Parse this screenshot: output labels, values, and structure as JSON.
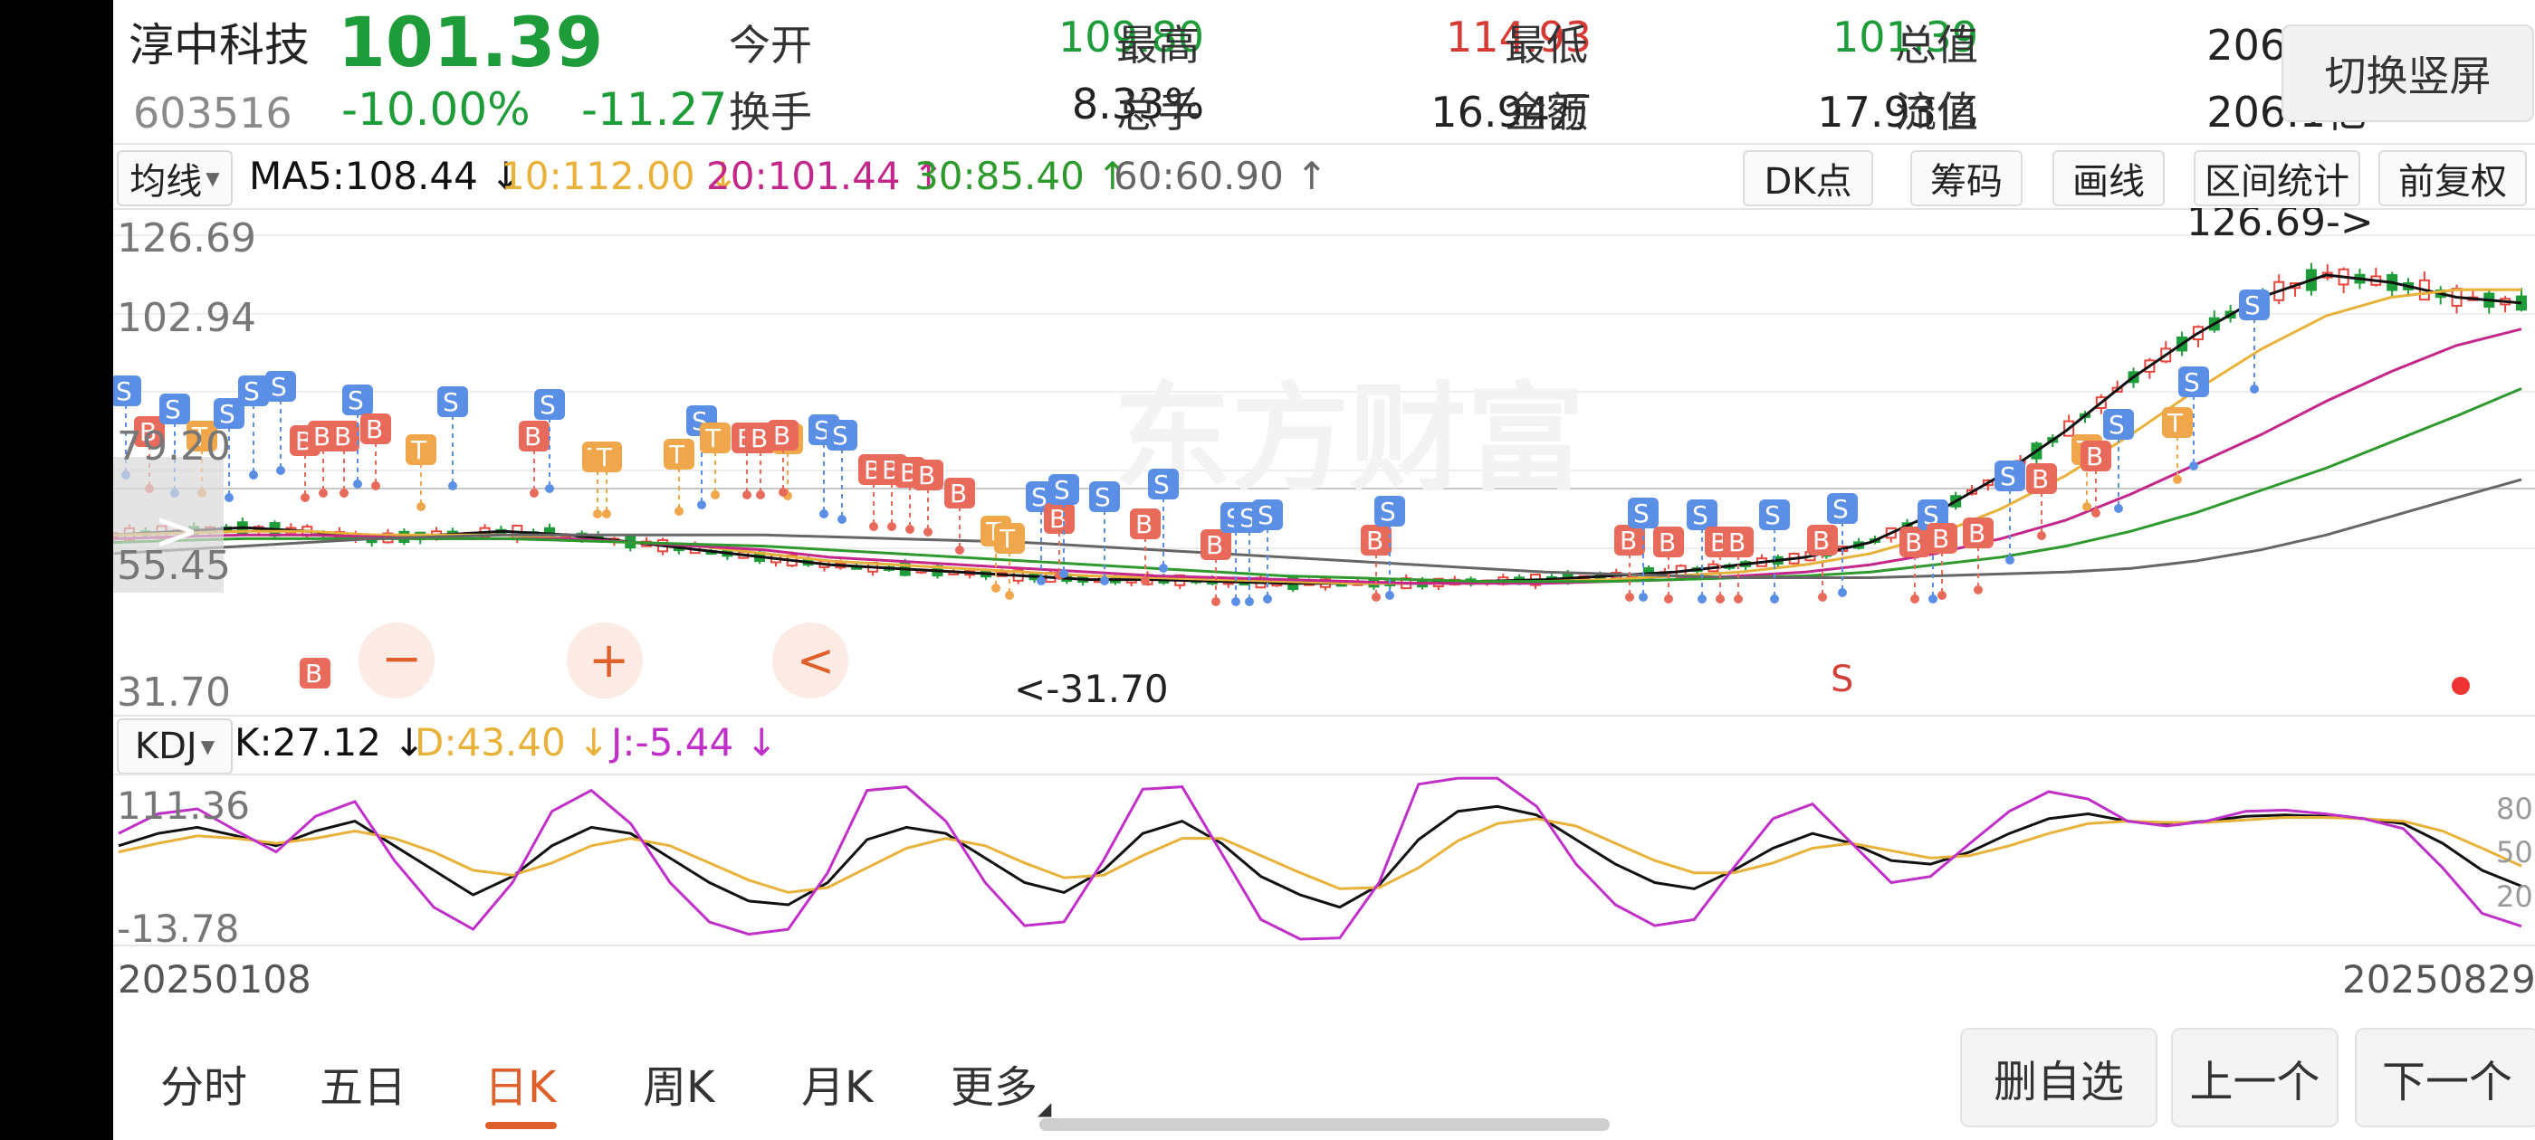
{
  "stock": {
    "name": "淳中科技",
    "price": "101.39",
    "code": "603516",
    "change_pct": "-10.00%",
    "change": "-11.27"
  },
  "quotes": {
    "open_label": "今开",
    "open": "109.80",
    "high_label": "最高",
    "high": "114.93",
    "low_label": "最低",
    "low": "101.39",
    "total_value_label": "总值",
    "total_value": "206.1亿",
    "turnover_label": "换手",
    "turnover": "8.33%",
    "volume_label": "总手",
    "volume": "16.94万",
    "amount_label": "金额",
    "amount": "17.93亿",
    "float_value_label": "流值",
    "float_value": "206.1亿"
  },
  "switch_button": "切换竖屏",
  "indicator": {
    "select": "均线",
    "ma5": "MA5:108.44 ↓",
    "ma10": "10:112.00 ↓",
    "ma20": "20:101.44 ↑",
    "ma30": "30:85.40 ↑",
    "ma60": "60:60.90 ↑"
  },
  "tools": [
    "DK点",
    "筹码",
    "画线",
    "区间统计",
    "前复权"
  ],
  "main_axis": {
    "y1": "126.69",
    "y2": "102.94",
    "y3": "79.20",
    "y4": "55.45",
    "y5": "31.70"
  },
  "annotations": {
    "high": "126.69->",
    "low": "<-31.70",
    "s_mark": "S"
  },
  "watermark": "东方财富",
  "overlay_buttons": {
    "minus": "−",
    "plus": "+",
    "back": "<",
    "expand": ">"
  },
  "kdj": {
    "select": "KDJ",
    "k": "K:27.12 ↓",
    "d": "D:43.40 ↓",
    "j": "J:-5.44 ↓"
  },
  "kdj_axis": {
    "top": "111.36",
    "bottom": "-13.78",
    "r80": "80",
    "r50": "50",
    "r20": "20"
  },
  "dates": {
    "start": "20250108",
    "end": "20250829"
  },
  "tabs": [
    {
      "label": "分时"
    },
    {
      "label": "五日"
    },
    {
      "label": "日K"
    },
    {
      "label": "周K"
    },
    {
      "label": "月K"
    },
    {
      "label": "更多"
    }
  ],
  "buttons": {
    "remove": "删自选",
    "prev": "上一个",
    "next": "下一个"
  },
  "colors": {
    "up": "#e8453c",
    "down": "#1f9c3a",
    "ma5": "#111111",
    "ma10": "#e8b23a",
    "ma20": "#c3278a",
    "ma30": "#2e9a2e",
    "ma60": "#666666",
    "j": "#c030c8",
    "accent": "#e0602c"
  },
  "chart_data": [
    {
      "type": "line",
      "title": "",
      "xlabel": "",
      "ylabel": "",
      "x_range": [
        "20250108",
        "20250829"
      ],
      "ylim": [
        31.7,
        126.69
      ],
      "yticks": [
        126.69,
        102.94,
        79.2,
        55.45,
        31.7
      ],
      "series": [
        {
          "name": "MA5",
          "values": [
            46,
            47,
            48,
            47,
            45,
            46,
            47,
            46,
            44,
            42,
            40,
            38,
            37,
            36,
            35,
            34,
            34,
            33.5,
            33,
            33,
            33,
            33.5,
            34,
            35,
            36,
            38,
            40,
            44,
            52,
            62,
            74,
            88,
            100,
            110,
            116,
            114,
            110,
            108.44
          ]
        },
        {
          "name": "MA10",
          "values": [
            46,
            46.5,
            47,
            47,
            46,
            46,
            46,
            45,
            44,
            43,
            41,
            39,
            38,
            37,
            36,
            35,
            34.5,
            34,
            33.5,
            33,
            33,
            33,
            33.5,
            34,
            35,
            36,
            38,
            41,
            46,
            53,
            62,
            73,
            85,
            96,
            105,
            110,
            112,
            112.0
          ]
        },
        {
          "name": "MA20",
          "values": [
            45,
            45.5,
            46,
            46,
            45.5,
            45,
            45,
            45,
            44,
            43,
            42,
            40,
            39,
            38,
            37,
            36,
            35,
            34.5,
            34,
            33.5,
            33,
            33,
            33,
            33.5,
            34,
            35,
            36,
            38,
            41,
            45,
            50,
            57,
            65,
            73,
            82,
            90,
            97,
            101.44
          ]
        },
        {
          "name": "MA30",
          "values": [
            44,
            44.5,
            45,
            45,
            45,
            45,
            45,
            44.5,
            44,
            43.5,
            43,
            42,
            41,
            40,
            39,
            38,
            37,
            36,
            35,
            34.5,
            34,
            33.5,
            33.5,
            33.5,
            34,
            34.5,
            35,
            36,
            38,
            40,
            43,
            47,
            52,
            58,
            64,
            71,
            78,
            85.4
          ]
        },
        {
          "name": "MA60",
          "values": [
            41,
            42,
            43,
            44,
            45,
            45.5,
            46,
            46,
            46,
            46,
            46,
            45.5,
            45,
            44.5,
            44,
            43,
            42,
            41,
            40,
            39,
            38,
            37,
            36,
            35.5,
            35,
            34.5,
            34.5,
            34.5,
            35,
            35.5,
            36,
            37,
            39,
            42,
            46,
            51,
            56,
            60.9
          ]
        }
      ]
    },
    {
      "type": "line",
      "title": "",
      "ylim": [
        -13.78,
        111.36
      ],
      "yticks": [
        111.36,
        -13.78
      ],
      "series": [
        {
          "name": "K",
          "values": [
            60,
            70,
            75,
            68,
            60,
            72,
            80,
            60,
            40,
            20,
            35,
            60,
            75,
            70,
            50,
            30,
            15,
            12,
            30,
            65,
            75,
            70,
            50,
            30,
            22,
            40,
            70,
            80,
            62,
            35,
            20,
            10,
            28,
            65,
            88,
            92,
            85,
            65,
            45,
            30,
            25,
            40,
            58,
            70,
            62,
            48,
            45,
            55,
            70,
            82,
            86,
            80,
            78,
            80,
            84,
            85,
            84,
            82,
            78,
            62,
            40,
            27.12
          ]
        },
        {
          "name": "D",
          "values": [
            55,
            62,
            68,
            66,
            62,
            66,
            72,
            66,
            55,
            40,
            36,
            46,
            60,
            66,
            60,
            46,
            32,
            22,
            26,
            42,
            58,
            66,
            60,
            46,
            34,
            36,
            52,
            66,
            66,
            52,
            38,
            25,
            26,
            42,
            64,
            78,
            82,
            76,
            62,
            48,
            38,
            38,
            46,
            58,
            62,
            56,
            50,
            52,
            60,
            70,
            78,
            80,
            79,
            79,
            81,
            83,
            83,
            82,
            80,
            72,
            58,
            43.4
          ]
        },
        {
          "name": "J",
          "values": [
            70,
            86,
            90,
            72,
            55,
            84,
            96,
            48,
            10,
            -8,
            30,
            88,
            105,
            78,
            30,
            -2,
            -12,
            -8,
            38,
            105,
            108,
            80,
            30,
            -5,
            -2,
            48,
            106,
            108,
            54,
            0,
            -16,
            -15,
            30,
            110,
            115,
            115,
            92,
            45,
            12,
            -5,
            0,
            42,
            82,
            94,
            62,
            30,
            35,
            62,
            88,
            104,
            98,
            80,
            76,
            80,
            88,
            89,
            86,
            82,
            74,
            42,
            5,
            -5.44
          ]
        }
      ]
    }
  ]
}
